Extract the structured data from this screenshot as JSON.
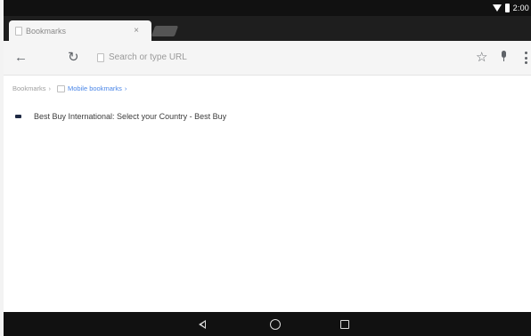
{
  "status_bar": {
    "time": "2:00"
  },
  "tab": {
    "title": "Bookmarks",
    "close_glyph": "×"
  },
  "toolbar": {
    "back_glyph": "←",
    "reload_glyph": "↻",
    "omnibox_placeholder": "Search or type URL",
    "star_glyph": "☆"
  },
  "breadcrumb": {
    "root": "Bookmarks",
    "separator": "›",
    "current": "Mobile bookmarks"
  },
  "bookmarks": [
    {
      "title": "Best Buy International: Select your Country - Best Buy"
    }
  ],
  "colors": {
    "accent": "#4a86e8",
    "status_bar": "#111111",
    "tab_strip": "#1e1e1e",
    "toolbar": "#f5f5f5"
  },
  "icons": {
    "status": [
      "wifi-icon",
      "battery-icon"
    ],
    "toolbar": [
      "back-arrow-icon",
      "reload-icon",
      "page-icon",
      "star-icon",
      "mic-icon",
      "overflow-menu-icon"
    ],
    "navigation": [
      "nav-back-icon",
      "nav-home-icon",
      "nav-recents-icon"
    ]
  }
}
